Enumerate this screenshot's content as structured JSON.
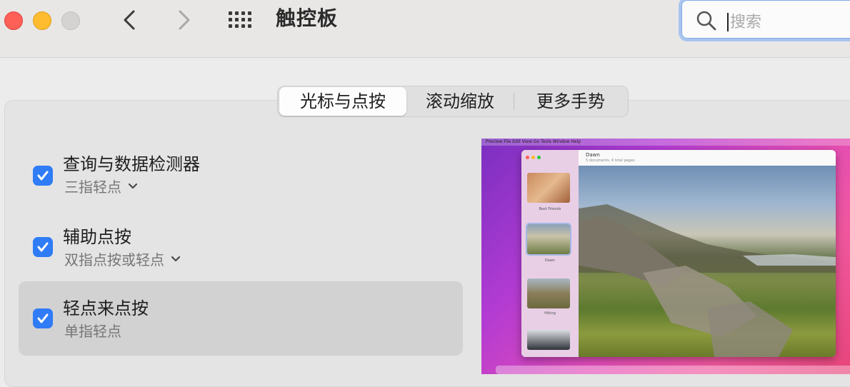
{
  "window": {
    "title": "触控板",
    "search": {
      "value": "",
      "placeholder": "搜索"
    }
  },
  "tabs": [
    {
      "label": "光标与点按",
      "selected": true
    },
    {
      "label": "滚动缩放",
      "selected": false
    },
    {
      "label": "更多手势",
      "selected": false
    }
  ],
  "options": [
    {
      "title": "查询与数据检测器",
      "subtitle": "三指轻点",
      "checked": true,
      "has_dropdown": true
    },
    {
      "title": "辅助点按",
      "subtitle": "双指点按或轻点",
      "checked": true,
      "has_dropdown": true
    },
    {
      "title": "轻点来点按",
      "subtitle": "单指轻点",
      "checked": true,
      "has_dropdown": false
    }
  ],
  "preview": {
    "menubar": "Preview   File   Edit   View   Go   Tools   Window   Help",
    "doc_title": "Dawn",
    "doc_subtitle": "5 documents, 4 total pages",
    "thumbnails": [
      {
        "caption": "Best Friends"
      },
      {
        "caption": "Dawn"
      },
      {
        "caption": "Hiking"
      }
    ]
  },
  "colors": {
    "accent": "#2f7cf6",
    "close": "#fe5f57",
    "minimize": "#febc2e",
    "zoom_disabled": "#d5d3d2"
  }
}
